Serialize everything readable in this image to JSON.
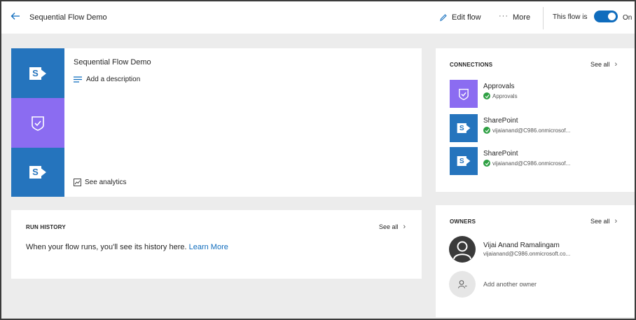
{
  "header": {
    "title": "Sequential Flow Demo",
    "edit_label": "Edit flow",
    "more_label": "More",
    "flow_status_label": "This flow is",
    "toggle_state": "On"
  },
  "flow": {
    "title": "Sequential Flow Demo",
    "add_description": "Add a description",
    "see_analytics": "See analytics",
    "step_icons": [
      "sharepoint-icon",
      "approvals-icon",
      "sharepoint-icon"
    ]
  },
  "run_history": {
    "heading": "RUN HISTORY",
    "see_all": "See all",
    "message": "When your flow runs, you'll see its history here.",
    "link": "Learn More"
  },
  "connections": {
    "heading": "CONNECTIONS",
    "see_all": "See all",
    "items": [
      {
        "name": "Approvals",
        "detail": "Approvals",
        "icon": "approvals-icon"
      },
      {
        "name": "SharePoint",
        "detail": "vijaianand@C986.onmicrosof...",
        "icon": "sharepoint-icon"
      },
      {
        "name": "SharePoint",
        "detail": "vijaianand@C986.onmicrosof...",
        "icon": "sharepoint-icon"
      }
    ]
  },
  "owners": {
    "heading": "OWNERS",
    "see_all": "See all",
    "items": [
      {
        "name": "Vijai Anand Ramalingam",
        "email": "vijaianand@C986.onmicrosoft.co..."
      }
    ],
    "add_label": "Add another owner"
  },
  "colors": {
    "accent": "#0f6cbd",
    "sharepoint": "#2574bd",
    "approvals": "#8b6cf1",
    "success": "#2ea043"
  }
}
